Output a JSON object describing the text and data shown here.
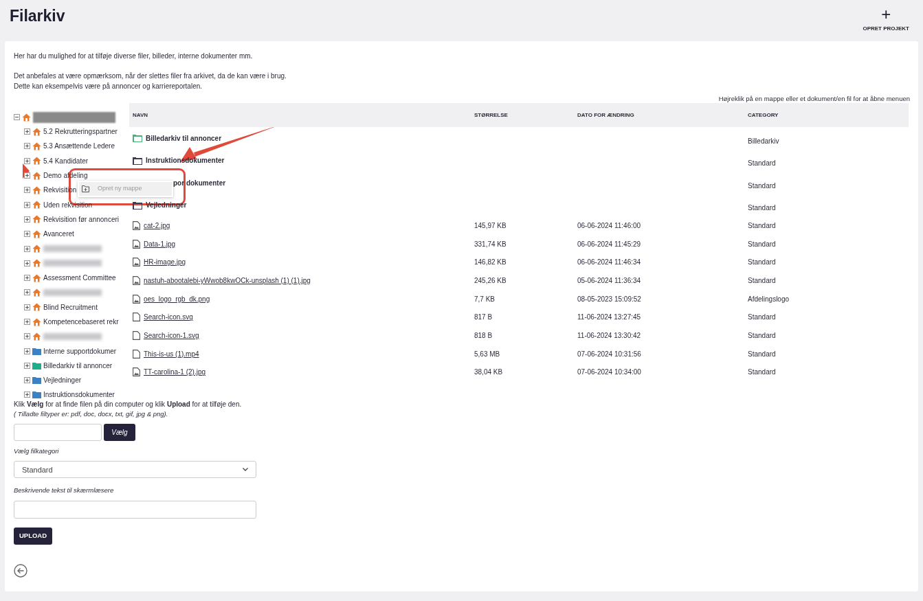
{
  "header": {
    "title": "Filarkiv",
    "action": {
      "icon": "+",
      "label": "OPRET PROJEKT"
    }
  },
  "intro": [
    "Her har du mulighed for at tilføje diverse filer, billeder, interne dokumenter mm.",
    "Det anbefales at være opmærksom, når der slettes filer fra arkivet, da de kan være i brug.",
    "Dette kan eksempelvis være på annoncer og karriereportalen."
  ],
  "hint": "Højreklik på en mappe eller et dokument/en fil for at åbne menuen",
  "tree": {
    "root": {
      "kind": "redacted",
      "expanded": true
    },
    "items": [
      {
        "kind": "department",
        "label": "5.2 Rekrutteringspartner"
      },
      {
        "kind": "department",
        "label": "5.3 Ansættende Ledere"
      },
      {
        "kind": "department",
        "label": "5.4 Kandidater"
      },
      {
        "kind": "department",
        "label": "Demo afdeling"
      },
      {
        "kind": "department",
        "label": "Rekvisition"
      },
      {
        "kind": "department",
        "label": "Uden rekvisition"
      },
      {
        "kind": "department",
        "label": "Rekvisition før annonceri"
      },
      {
        "kind": "department",
        "label": "Avanceret"
      },
      {
        "kind": "redacted"
      },
      {
        "kind": "redacted"
      },
      {
        "kind": "department",
        "label": "Assessment Committee"
      },
      {
        "kind": "redacted"
      },
      {
        "kind": "department",
        "label": "Blind Recruitment"
      },
      {
        "kind": "department",
        "label": "Kompetencebaseret rekr"
      },
      {
        "kind": "redacted"
      },
      {
        "kind": "folder",
        "color": "#3b82c4",
        "label": "Interne supportdokumer"
      },
      {
        "kind": "folder",
        "color": "#1fae8c",
        "label": "Billedarkiv til annoncer"
      },
      {
        "kind": "folder",
        "color": "#3b82c4",
        "label": "Vejledninger"
      },
      {
        "kind": "folder",
        "color": "#3b82c4",
        "label": "Instruktionsdokumenter"
      }
    ]
  },
  "context_menu": {
    "items": [
      {
        "label": "Opret ny mappe",
        "disabled": true
      }
    ]
  },
  "table": {
    "columns": [
      "NAVN",
      "STØRRELSE",
      "DATO FOR ÆNDRING",
      "CATEGORY"
    ],
    "rows": [
      {
        "kind": "folder",
        "color": "#4caf7a",
        "name": "Billedarkiv til annoncer",
        "category": "Billedarkiv"
      },
      {
        "kind": "folder",
        "color": "#3a3a50",
        "name": "Instruktionsdokumenter",
        "category": "Standard"
      },
      {
        "kind": "covered-folder",
        "name": "por dokumenter",
        "category": "Standard"
      },
      {
        "kind": "folder",
        "color": "#3a3a50",
        "name": "Vejledninger",
        "category": "Standard"
      },
      {
        "kind": "image",
        "name": "cat-2.jpg",
        "size": "145,97 KB",
        "date": "06-06-2024 11:46:00",
        "category": "Standard"
      },
      {
        "kind": "image",
        "name": "Data-1.jpg",
        "size": "331,74 KB",
        "date": "06-06-2024 11:45:29",
        "category": "Standard"
      },
      {
        "kind": "image",
        "name": "HR-image.jpg",
        "size": "146,82 KB",
        "date": "06-06-2024 11:46:34",
        "category": "Standard"
      },
      {
        "kind": "image",
        "name": "nastuh-abootalebi-yWwob8kwOCk-unsplash (1) (1).jpg",
        "size": "245,26 KB",
        "date": "05-06-2024 11:36:34",
        "category": "Standard"
      },
      {
        "kind": "image",
        "name": "oes_logo_rgb_dk.png",
        "size": "7,7 KB",
        "date": "08-05-2023 15:09:52",
        "category": "Afdelingslogo"
      },
      {
        "kind": "file",
        "name": "Search-icon.svg",
        "size": "817 B",
        "date": "11-06-2024 13:27:45",
        "category": "Standard"
      },
      {
        "kind": "file",
        "name": "Search-icon-1.svg",
        "size": "818 B",
        "date": "11-06-2024 13:30:42",
        "category": "Standard"
      },
      {
        "kind": "file",
        "name": "This-is-us (1).mp4",
        "size": "5,63 MB",
        "date": "07-06-2024 10:31:56",
        "category": "Standard"
      },
      {
        "kind": "image",
        "name": "TT-carolina-1 (2).jpg",
        "size": "38,04 KB",
        "date": "07-06-2024 10:34:00",
        "category": "Standard"
      }
    ]
  },
  "upload": {
    "instructions": "Klik **Vælg** for at finde filen på din computer og klik **Upload** for at tilføje den.",
    "filetypes": "( Tilladte filtyper er: pdf, doc, docx, txt, gif, jpg & png).",
    "choose_button": "Vælg",
    "category_label": "Vælg filkategori",
    "category_value": "Standard",
    "description_label": "Beskrivende tekst til skærmlæsere",
    "upload_button": "UPLOAD"
  }
}
